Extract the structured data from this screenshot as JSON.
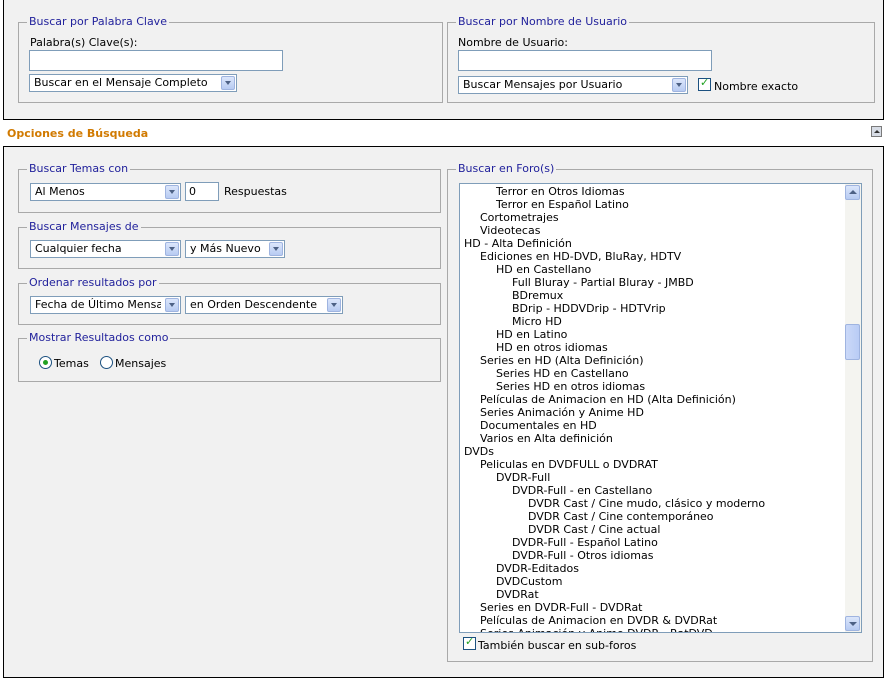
{
  "keyword": {
    "legend": "Buscar por Palabra Clave",
    "label": "Palabra(s) Clave(s):",
    "value": "",
    "scope": "Buscar en el Mensaje Completo"
  },
  "username": {
    "legend": "Buscar por Nombre de Usuario",
    "label": "Nombre de Usuario:",
    "value": "",
    "mode": "Buscar Mensajes por Usuario",
    "exact_label": "Nombre exacto",
    "exact_checked": true
  },
  "options": {
    "title": "Opciones de Búsqueda"
  },
  "topics": {
    "legend": "Buscar Temas con",
    "operator": "Al Menos",
    "count": "0",
    "suffix": "Respuestas"
  },
  "posts": {
    "legend": "Buscar Mensajes de",
    "date": "Cualquier fecha",
    "direction": "y Más Nuevo"
  },
  "sort": {
    "legend": "Ordenar resultados por",
    "field": "Fecha de Último Mensaje",
    "order": "en Orden Descendente"
  },
  "display": {
    "legend": "Mostrar Resultados como",
    "opt_topics": "Temas",
    "opt_posts": "Mensajes",
    "selected": "Temas"
  },
  "forums": {
    "legend": "Buscar en Foro(s)",
    "items": [
      {
        "label": "Terror en Otros Idiomas",
        "level": 3
      },
      {
        "label": "Terror en Español Latino",
        "level": 3
      },
      {
        "label": "Cortometrajes",
        "level": 2
      },
      {
        "label": "Videotecas",
        "level": 2
      },
      {
        "label": "HD - Alta Definición",
        "level": 1
      },
      {
        "label": "Ediciones en HD-DVD, BluRay, HDTV",
        "level": 2
      },
      {
        "label": "HD en Castellano",
        "level": 3
      },
      {
        "label": "Full Bluray - Partial Bluray - JMBD",
        "level": 4
      },
      {
        "label": "BDremux",
        "level": 4
      },
      {
        "label": "BDrip - HDDVDrip - HDTVrip",
        "level": 4
      },
      {
        "label": "Micro HD",
        "level": 4
      },
      {
        "label": "HD en Latino",
        "level": 3
      },
      {
        "label": "HD en otros idiomas",
        "level": 3
      },
      {
        "label": "Series en HD (Alta Definición)",
        "level": 2
      },
      {
        "label": "Series HD en Castellano",
        "level": 3
      },
      {
        "label": "Series HD en otros idiomas",
        "level": 3
      },
      {
        "label": "Películas de Animacion en HD (Alta Definición)",
        "level": 2
      },
      {
        "label": "Series Animación y Anime HD",
        "level": 2
      },
      {
        "label": "Documentales en HD",
        "level": 2
      },
      {
        "label": "Varios en Alta definición",
        "level": 2
      },
      {
        "label": "DVDs",
        "level": 1
      },
      {
        "label": "Peliculas en DVDFULL o DVDRAT",
        "level": 2
      },
      {
        "label": "DVDR-Full",
        "level": 3
      },
      {
        "label": "DVDR-Full - en Castellano",
        "level": 4
      },
      {
        "label": "DVDR Cast / Cine mudo, clásico y moderno",
        "level": 5
      },
      {
        "label": "DVDR Cast / Cine contemporáneo",
        "level": 5
      },
      {
        "label": "DVDR Cast / Cine actual",
        "level": 5
      },
      {
        "label": "DVDR-Full - Español Latino",
        "level": 4
      },
      {
        "label": "DVDR-Full - Otros idiomas",
        "level": 4
      },
      {
        "label": "DVDR-Editados",
        "level": 3
      },
      {
        "label": "DVDCustom",
        "level": 3
      },
      {
        "label": "DVDRat",
        "level": 3
      },
      {
        "label": "Series en DVDR-Full - DVDRat",
        "level": 2
      },
      {
        "label": "Películas de Animacion en DVDR & DVDRat",
        "level": 2
      },
      {
        "label": "Series Animación y Anime DVDR - RatDVD",
        "level": 2
      }
    ],
    "subforums_label": "También buscar en sub-foros",
    "subforums_checked": true
  }
}
